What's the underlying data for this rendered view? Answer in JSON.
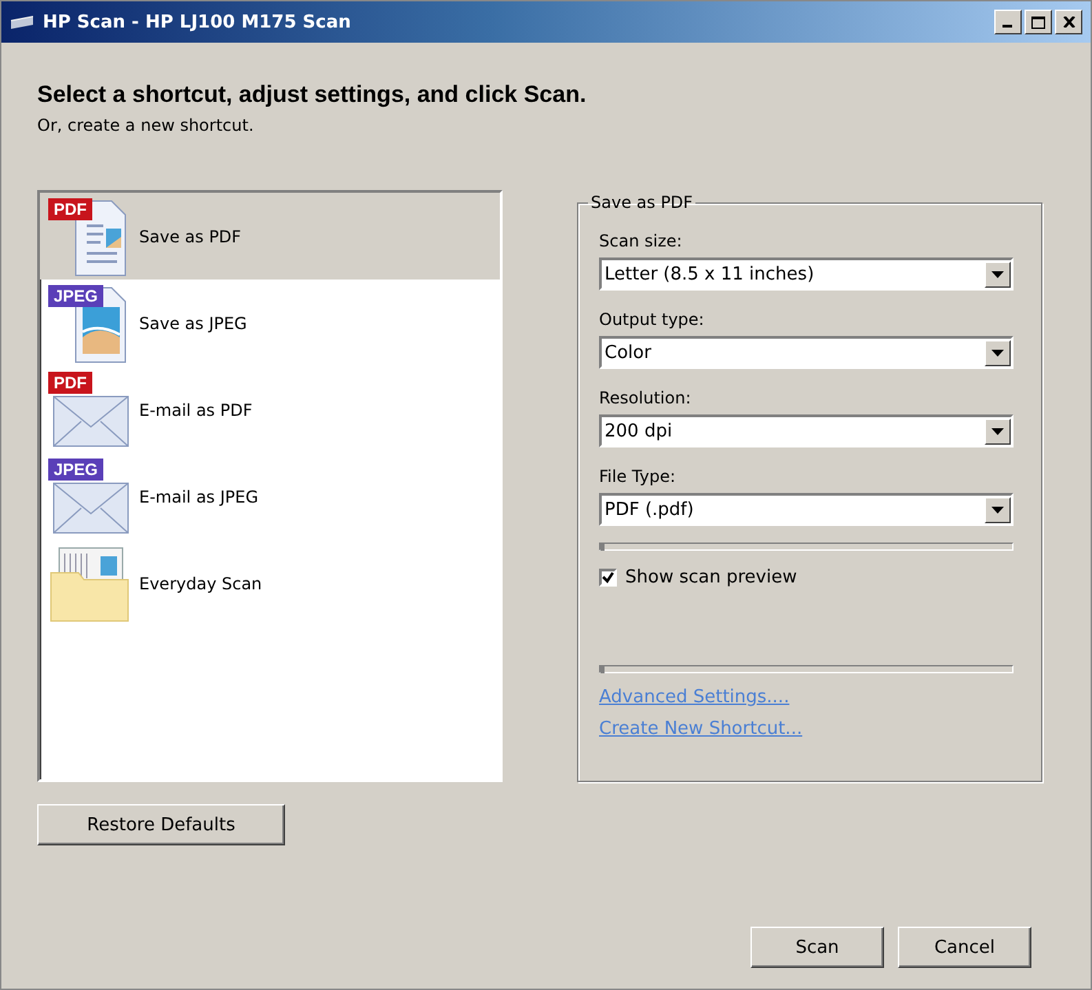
{
  "window": {
    "title": "HP Scan - HP LJ100 M175 Scan"
  },
  "header": {
    "title": "Select a shortcut, adjust settings, and click Scan.",
    "subtitle": "Or, create a new shortcut."
  },
  "shortcuts": [
    {
      "label": "Save as PDF",
      "badge": "PDF",
      "kind": "document",
      "color": "#c8141c",
      "selected": true
    },
    {
      "label": "Save as JPEG",
      "badge": "JPEG",
      "kind": "photo",
      "color": "#5a3fb8",
      "selected": false
    },
    {
      "label": "E-mail as PDF",
      "badge": "PDF",
      "kind": "envelope",
      "color": "#c8141c",
      "selected": false
    },
    {
      "label": "E-mail as JPEG",
      "badge": "JPEG",
      "kind": "envelope",
      "color": "#5a3fb8",
      "selected": false
    },
    {
      "label": "Everyday Scan",
      "kind": "folder",
      "selected": false
    }
  ],
  "settings": {
    "title": "Save as PDF",
    "fields": [
      {
        "label": "Scan size:",
        "value": "Letter (8.5 x 11 inches)"
      },
      {
        "label": "Output type:",
        "value": "Color"
      },
      {
        "label": "Resolution:",
        "value": "200 dpi"
      },
      {
        "label": "File Type:",
        "value": "PDF (.pdf)"
      }
    ],
    "sliders": [
      {
        "level": 0
      },
      {
        "level": 0
      }
    ],
    "show_preview": {
      "label": "Show scan preview",
      "checked": true
    },
    "links": [
      "Advanced Settings....",
      "Create New Shortcut..."
    ]
  },
  "restore_button": "Restore Defaults",
  "buttons": [
    "Scan",
    "Cancel"
  ]
}
